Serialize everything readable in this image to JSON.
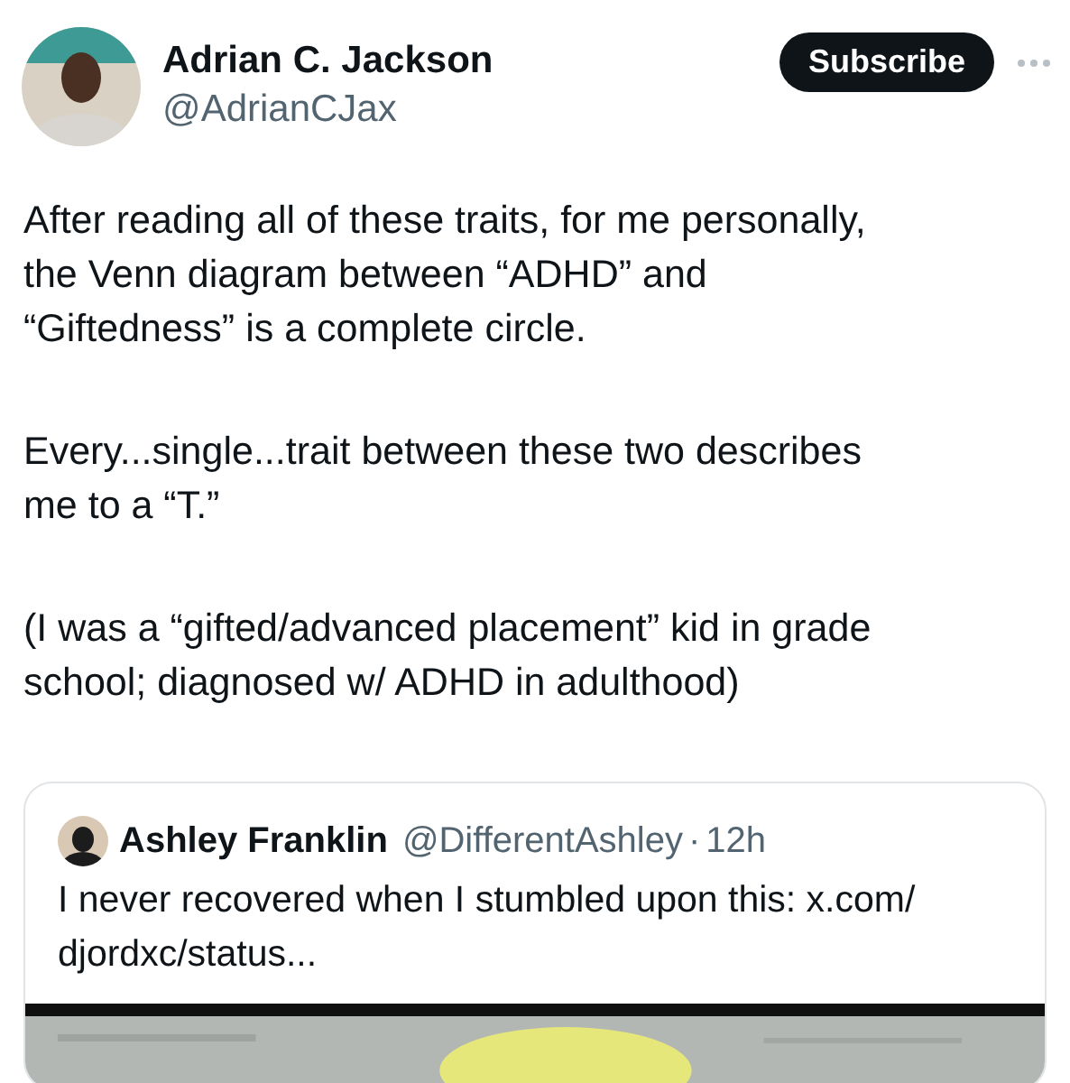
{
  "author": {
    "name": "Adrian C. Jackson",
    "handle": "@AdrianCJax"
  },
  "subscribe_button": "Subscribe",
  "paragraphs": [
    {
      "lines": [
        "After reading all of these traits, for me personally,",
        "the Venn diagram between “ADHD” and",
        "“Giftedness” is a complete circle."
      ]
    },
    {
      "lines": [
        "Every...single...trait between these two describes",
        "me to a “T.”"
      ]
    },
    {
      "lines": [
        "(I was a “gifted/advanced placement” kid in grade",
        "school; diagnosed w/ ADHD in adulthood)"
      ]
    }
  ],
  "quoted_post": {
    "name": "Ashley Franklin",
    "handle": "@DifferentAshley",
    "separator": "·",
    "time": "12h",
    "lines": [
      "I never recovered when I stumbled upon this: x.com/",
      "djordxc/status..."
    ],
    "media": {
      "kind": "picture"
    }
  }
}
